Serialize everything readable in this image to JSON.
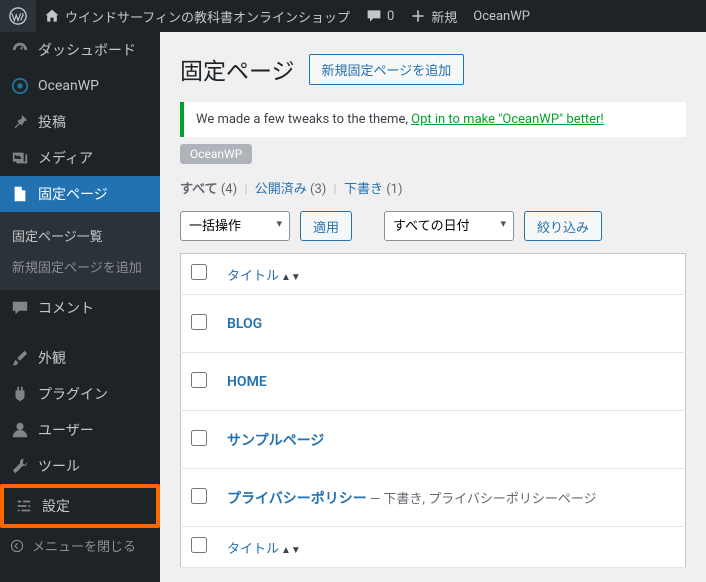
{
  "topbar": {
    "site_name": "ウインドサーフィンの教科書オンラインショップ",
    "comments_count": "0",
    "new_label": "新規",
    "user_label": "OceanWP"
  },
  "sidebar": {
    "dashboard": "ダッシュボード",
    "oceanwp": "OceanWP",
    "posts": "投稿",
    "media": "メディア",
    "pages": "固定ページ",
    "pages_list": "固定ページ一覧",
    "pages_new": "新規固定ページを追加",
    "comments": "コメント",
    "appearance": "外観",
    "plugins": "プラグイン",
    "users": "ユーザー",
    "tools": "ツール",
    "settings": "設定",
    "collapse": "メニューを閉じる"
  },
  "page": {
    "title": "固定ページ",
    "add_new": "新規固定ページを追加"
  },
  "notice": {
    "text": "We made a few tweaks to the theme, ",
    "link": "Opt in to make \"OceanWP\" better!"
  },
  "tag": "OceanWP",
  "filters": {
    "all_label": "すべて",
    "all_count": "(4)",
    "published_label": "公開済み",
    "published_count": "(3)",
    "draft_label": "下書き",
    "draft_count": "(1)"
  },
  "tablenav": {
    "bulk_action": "一括操作",
    "apply": "適用",
    "all_dates": "すべての日付",
    "filter": "絞り込み"
  },
  "table": {
    "col_title": "タイトル",
    "rows": [
      {
        "title": "BLOG",
        "state": ""
      },
      {
        "title": "HOME",
        "state": ""
      },
      {
        "title": "サンプルページ",
        "state": ""
      },
      {
        "title": "プライバシーポリシー",
        "state": " — 下書き, プライバシーポリシーページ"
      }
    ]
  }
}
